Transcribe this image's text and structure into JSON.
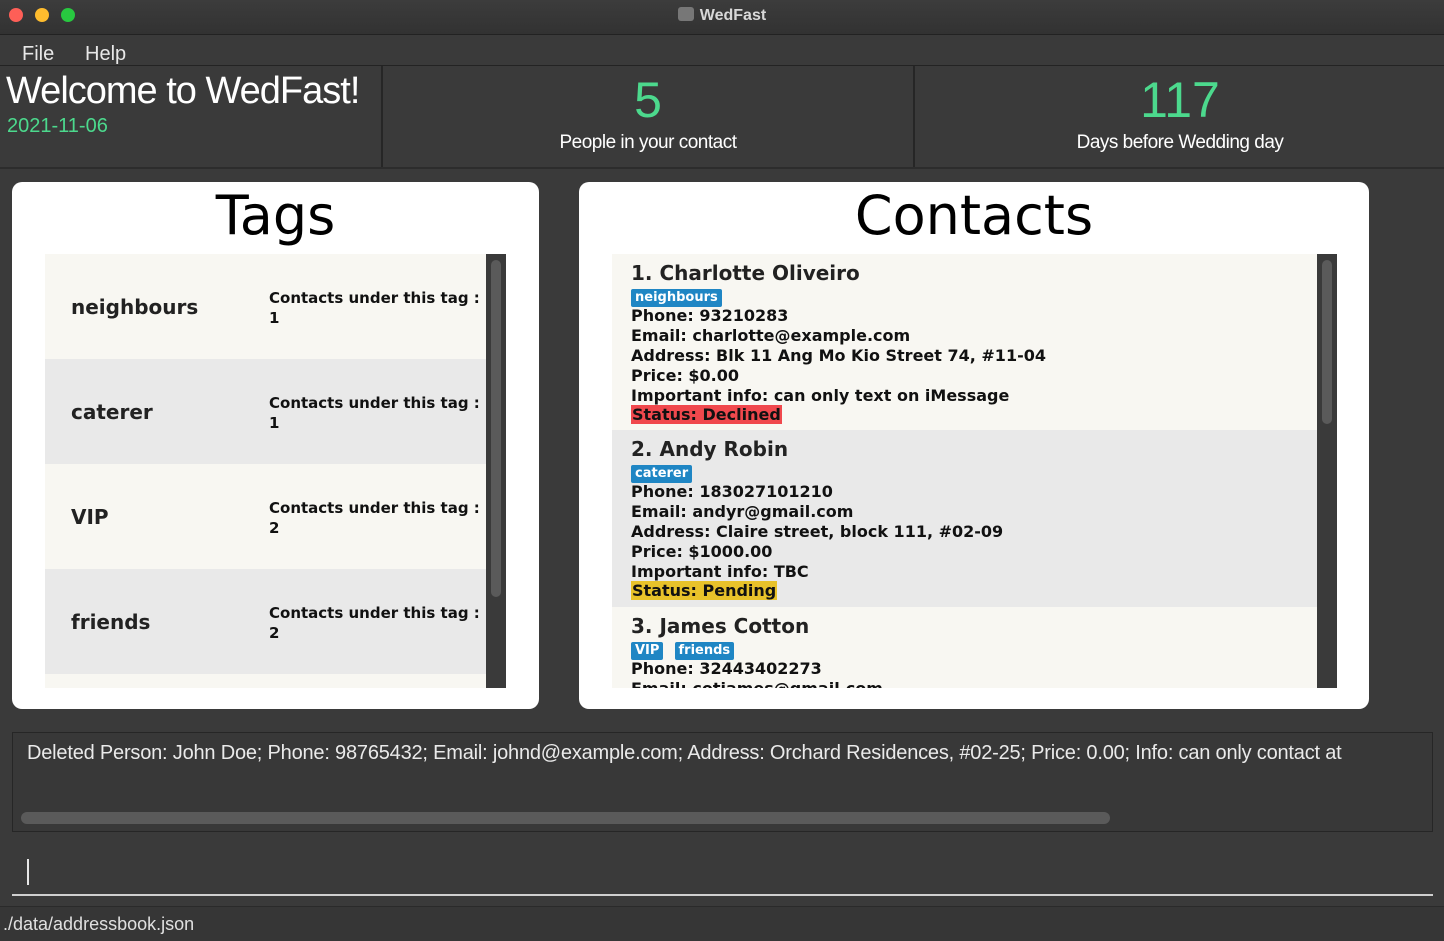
{
  "window": {
    "title": "WedFast"
  },
  "menu": {
    "file": "File",
    "help": "Help"
  },
  "header": {
    "welcome": "Welcome to WedFast!",
    "date": "2021-11-06",
    "people_count": "5",
    "people_label": "People in your contact",
    "days_count": "117",
    "days_label": "Days before Wedding day"
  },
  "tags_panel": {
    "title": "Tags",
    "count_label": "Contacts under this tag :",
    "items": [
      {
        "name": "neighbours",
        "count": "1"
      },
      {
        "name": "caterer",
        "count": "1"
      },
      {
        "name": "VIP",
        "count": "2"
      },
      {
        "name": "friends",
        "count": "2"
      }
    ]
  },
  "contacts_panel": {
    "title": "Contacts",
    "items": [
      {
        "name": "1.  Charlotte Oliveiro",
        "tags": [
          "neighbours"
        ],
        "phone": "Phone: 93210283",
        "email": "Email: charlotte@example.com",
        "address": "Address: Blk 11 Ang Mo Kio Street 74, #11-04",
        "price": "Price: $0.00",
        "info": "Important info: can only text on iMessage",
        "status": "Status: Declined",
        "status_color": "#f0484d"
      },
      {
        "name": "2.  Andy Robin",
        "tags": [
          "caterer"
        ],
        "phone": "Phone: 183027101210",
        "email": "Email: andyr@gmail.com",
        "address": "Address: Claire street, block 111, #02-09",
        "price": "Price: $1000.00",
        "info": "Important info: TBC",
        "status": "Status: Pending",
        "status_color": "#e8c22a"
      },
      {
        "name": "3.  James Cotton",
        "tags": [
          "VIP",
          "friends"
        ],
        "phone": "Phone: 32443402273",
        "email": "Email: cotjames@gmail.com"
      }
    ]
  },
  "result": {
    "text": "Deleted Person: John Doe; Phone: 98765432; Email: johnd@example.com; Address: Orchard Residences, #02-25; Price: 0.00; Info: can only contact at"
  },
  "command": {
    "value": ""
  },
  "status_bar": {
    "path": "./data/addressbook.json"
  },
  "colors": {
    "accent_green": "#4cd98d",
    "tag_chip": "#1f86c4"
  }
}
